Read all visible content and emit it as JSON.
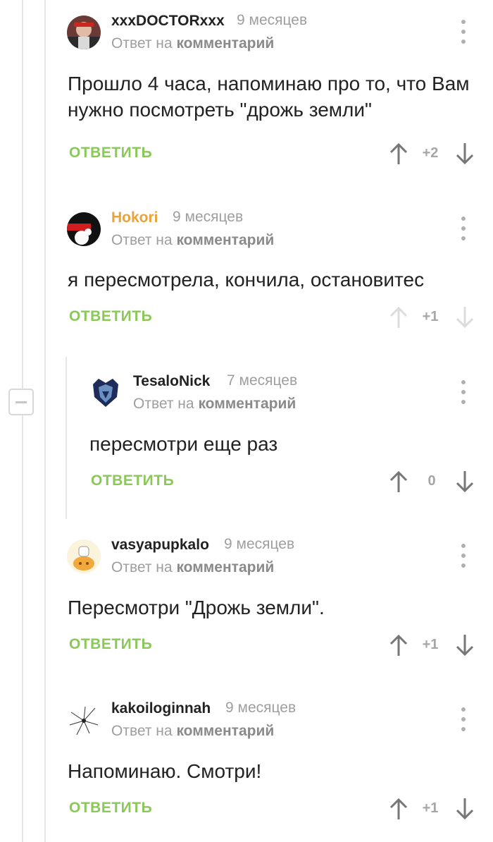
{
  "common": {
    "reply_to_prefix": "Ответ на",
    "reply_to_target": "комментарий",
    "reply_button": "ОТВЕТИТЬ"
  },
  "comments": [
    {
      "author": "xxxDOCTORxxx",
      "author_color": "#222222",
      "time": "9 месяцев",
      "text": "Прошло 4 часа, напоминаю про то, что Вам нужно посмотреть \"дрожь земли\"",
      "rating": "+2"
    },
    {
      "author": "Hokori",
      "author_color": "#e8a33d",
      "time": "9 месяцев",
      "text": "я пересмотрела, кончила, остановитес",
      "rating": "+1"
    },
    {
      "author": "TesaloNick",
      "author_color": "#222222",
      "time": "7 месяцев",
      "text": "пересмотри еще раз",
      "rating": "0"
    },
    {
      "author": "vasyapupkalo",
      "author_color": "#222222",
      "time": "9 месяцев",
      "text": "Пересмотри \"Дрожь земли\".",
      "rating": "+1"
    },
    {
      "author": "kakoiloginnah",
      "author_color": "#222222",
      "time": "9 месяцев",
      "text": "Напоминаю. Смотри!",
      "rating": "+1"
    }
  ],
  "colors": {
    "accent_green": "#8ac858",
    "meta_gray": "#9e9e9e",
    "hokori_orange": "#e8a33d"
  }
}
